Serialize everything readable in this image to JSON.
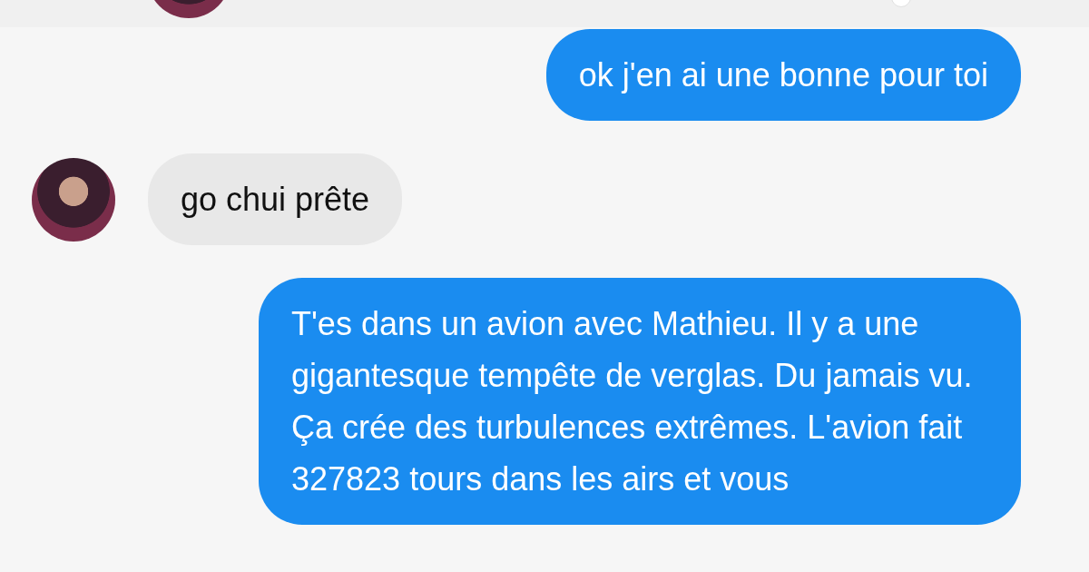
{
  "messages": [
    {
      "kind": "outgoing",
      "text": "ok j'en ai une bonne pour toi"
    },
    {
      "kind": "incoming",
      "text": "go chui prête"
    },
    {
      "kind": "outgoing",
      "text": "T'es dans un avion avec Mathieu. Il y a une gigantesque tempête de verglas. Du jamais vu. Ça crée des turbulences extrêmes. L'avion fait 327823 tours dans les airs et vous"
    }
  ]
}
